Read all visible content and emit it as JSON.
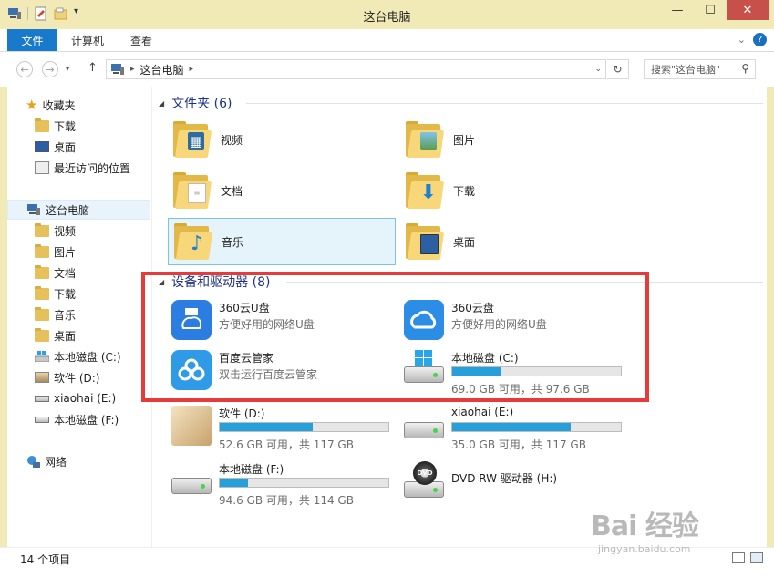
{
  "window": {
    "title": "这台电脑"
  },
  "ribbon": {
    "tabs": [
      "文件",
      "计算机",
      "查看"
    ]
  },
  "address": {
    "path": [
      "这台电脑"
    ],
    "search_placeholder": "搜索\"这台电脑\""
  },
  "nav": {
    "favorites": {
      "label": "收藏夹",
      "items": [
        "下载",
        "桌面",
        "最近访问的位置"
      ]
    },
    "this_pc": {
      "label": "这台电脑",
      "items": [
        "视频",
        "图片",
        "文档",
        "下载",
        "音乐",
        "桌面",
        "本地磁盘 (C:)",
        "软件 (D:)",
        "xiaohai (E:)",
        "本地磁盘 (F:)"
      ]
    },
    "network": {
      "label": "网络"
    }
  },
  "folders_group": {
    "label": "文件夹 (6)",
    "items": [
      "视频",
      "图片",
      "文档",
      "下载",
      "音乐",
      "桌面"
    ]
  },
  "devices_group": {
    "label": "设备和驱动器 (8)",
    "apps": [
      {
        "name": "360云U盘",
        "subtitle": "方便好用的网络U盘",
        "icon": "usb-cloud-icon",
        "color": "#2b7de1"
      },
      {
        "name": "360云盘",
        "subtitle": "方便好用的网络U盘",
        "icon": "cloud-icon",
        "color": "#2b8de6"
      },
      {
        "name": "百度云管家",
        "subtitle": "双击运行百度云管家",
        "icon": "baidu-cloud-icon",
        "color": "#2f9be6"
      }
    ],
    "drives": [
      {
        "name": "本地磁盘 (C:)",
        "usage": 0.29,
        "free_text": "69.0 GB 可用，共 97.6 GB"
      },
      {
        "name": "软件 (D:)",
        "usage": 0.55,
        "free_text": "52.6 GB 可用，共 117 GB"
      },
      {
        "name": "xiaohai (E:)",
        "usage": 0.7,
        "free_text": "35.0 GB 可用，共 117 GB"
      },
      {
        "name": "本地磁盘 (F:)",
        "usage": 0.17,
        "free_text": "94.6 GB 可用，共 114 GB"
      }
    ],
    "dvd": {
      "name": "DVD RW 驱动器 (H:)"
    }
  },
  "status": {
    "count_text": "14 个项目"
  },
  "watermark": {
    "line1": "Bai 经验",
    "line2": "jingyan.baidu.com"
  },
  "colors": {
    "accent": "#1979ca",
    "bar": "#26a0da",
    "highlight": "#e73a3a"
  }
}
